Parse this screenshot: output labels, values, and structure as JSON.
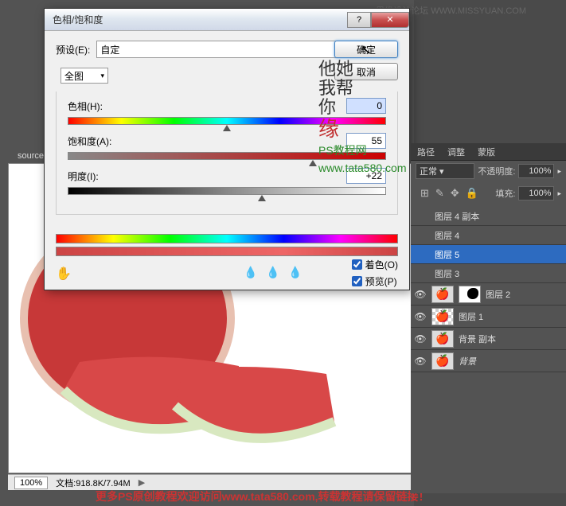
{
  "header_watermark": "思缘设计论坛 WWW.MISSYUAN.COM",
  "doc_tab": "source...",
  "dialog": {
    "title": "色相/饱和度",
    "preset_label": "预设(E):",
    "preset_value": "自定",
    "channel_value": "全图",
    "hue_label": "色相(H):",
    "hue_value": "0",
    "sat_label": "饱和度(A):",
    "sat_value": "55",
    "light_label": "明度(I):",
    "light_value": "+22",
    "ok": "确定",
    "cancel": "取消",
    "colorize": "着色(O)",
    "preview": "预览(P)"
  },
  "stamp": {
    "l1": "他她",
    "l2": "我帮",
    "l3": "你",
    "l4": "缘",
    "site1": "PS教程网",
    "site2": "www.tata580.com"
  },
  "panels": {
    "tabs": [
      "路径",
      "调整",
      "蒙版"
    ],
    "opacity_label": "不透明度:",
    "opacity_value": "100%",
    "fill_label": "填充:",
    "fill_value": "100%",
    "normal": "正常"
  },
  "layers": [
    {
      "name": "图层 4 副本"
    },
    {
      "name": "图层 4"
    },
    {
      "name": "图层 5"
    },
    {
      "name": "图层 3"
    },
    {
      "name": "图层 2"
    },
    {
      "name": "图层 1"
    },
    {
      "name": "背景 副本"
    },
    {
      "name": "背景"
    }
  ],
  "status": {
    "zoom": "100%",
    "doc_info": "文档:918.8K/7.94M"
  },
  "footer": "更多PS原创教程欢迎访问www.tata580.com,转载教程请保留链接！"
}
